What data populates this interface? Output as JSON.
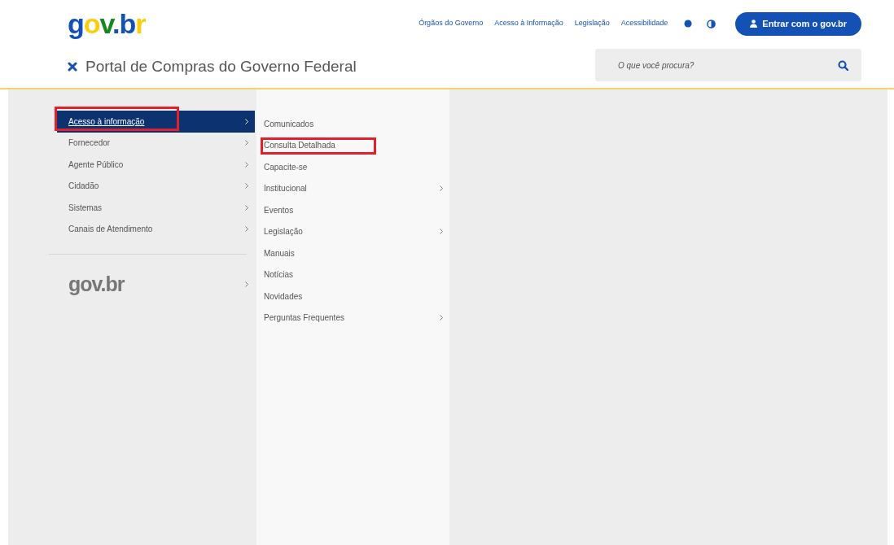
{
  "header": {
    "logo": "gov.br",
    "links": [
      "Órgãos do Governo",
      "Acesso à Informação",
      "Legislação",
      "Acessibilidade"
    ],
    "login_button": "Entrar com o gov.br",
    "site_title": "Portal de Compras do Governo Federal",
    "search": {
      "placeholder": "O que você procura?"
    }
  },
  "menu": {
    "items": [
      {
        "label": "Acesso à informação",
        "selected": true,
        "highlighted": true,
        "has_submenu": true
      },
      {
        "label": "Fornecedor",
        "selected": false,
        "highlighted": false,
        "has_submenu": true
      },
      {
        "label": "Agente Público",
        "selected": false,
        "highlighted": false,
        "has_submenu": true
      },
      {
        "label": "Cidadão",
        "selected": false,
        "highlighted": false,
        "has_submenu": true
      },
      {
        "label": "Sistemas",
        "selected": false,
        "highlighted": false,
        "has_submenu": true
      },
      {
        "label": "Canais de Atendimento",
        "selected": false,
        "highlighted": false,
        "has_submenu": true
      }
    ],
    "footer_logo": "gov.br"
  },
  "submenu": {
    "items": [
      {
        "label": "Comunicados",
        "highlighted": false,
        "has_submenu": false
      },
      {
        "label": "Consulta Detalhada",
        "highlighted": true,
        "has_submenu": false
      },
      {
        "label": "Capacite-se",
        "highlighted": false,
        "has_submenu": false
      },
      {
        "label": "Institucional",
        "highlighted": false,
        "has_submenu": true
      },
      {
        "label": "Eventos",
        "highlighted": false,
        "has_submenu": false
      },
      {
        "label": "Legislação",
        "highlighted": false,
        "has_submenu": true
      },
      {
        "label": "Manuais",
        "highlighted": false,
        "has_submenu": false
      },
      {
        "label": "Notícias",
        "highlighted": false,
        "has_submenu": false
      },
      {
        "label": "Novidades",
        "highlighted": false,
        "has_submenu": false
      },
      {
        "label": "Perguntas Frequentes",
        "highlighted": false,
        "has_submenu": true
      }
    ]
  }
}
